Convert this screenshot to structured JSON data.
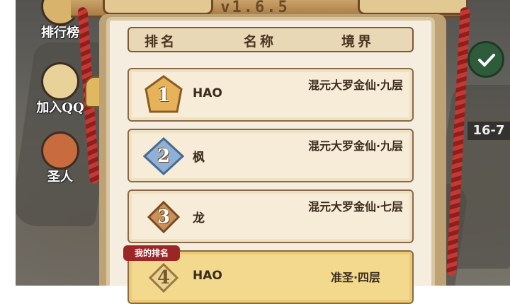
{
  "version": "v1.6.5",
  "side_menu": [
    {
      "label": "排行榜",
      "icon": "trophy-icon"
    },
    {
      "label": "加入QQ",
      "icon": "penguin-icon"
    },
    {
      "label": "圣人",
      "icon": "gift-icon"
    }
  ],
  "right_hud": {
    "level": "16-7",
    "icon": "check-icon"
  },
  "table": {
    "headers": [
      "排名",
      "名称",
      "境界"
    ],
    "rows": [
      {
        "rank": "1",
        "name": "HAO",
        "realm": "混元大罗金仙·九层",
        "medal_color": "#e6b25a"
      },
      {
        "rank": "2",
        "name": "枫",
        "realm": "混元大罗金仙·九层",
        "medal_color": "#8fb1d8"
      },
      {
        "rank": "3",
        "name": "龙",
        "realm": "混元大罗金仙·七层",
        "medal_color": "#c9905a"
      }
    ],
    "my_rank_label": "我的排名",
    "my_rank": {
      "rank": "4",
      "name": "HAO",
      "realm": "准圣·四层"
    }
  }
}
